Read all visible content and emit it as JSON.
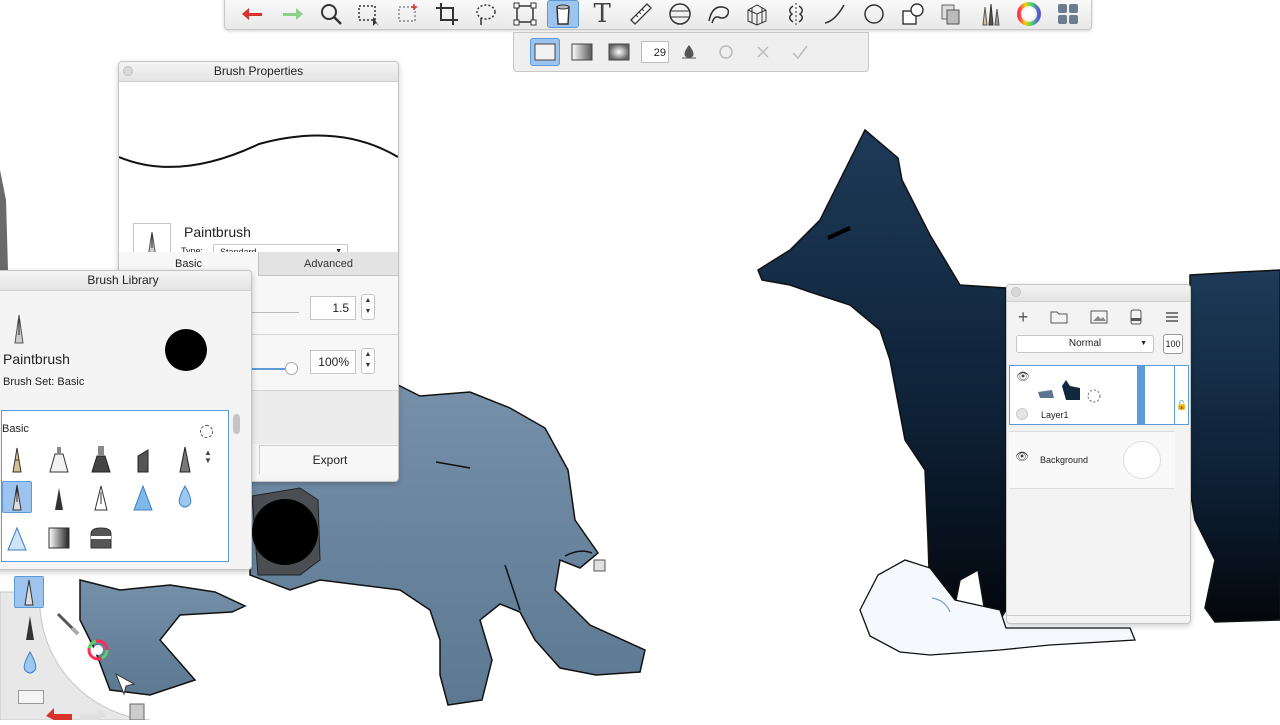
{
  "toolbar": {
    "tools": [
      {
        "name": "undo",
        "icon": "undo-arrow-icon"
      },
      {
        "name": "redo",
        "icon": "redo-arrow-icon"
      },
      {
        "name": "zoom",
        "icon": "magnifier-icon"
      },
      {
        "name": "select",
        "icon": "marquee-select-icon"
      },
      {
        "name": "select-add",
        "icon": "marquee-add-icon"
      },
      {
        "name": "crop",
        "icon": "crop-icon"
      },
      {
        "name": "lasso",
        "icon": "lasso-icon"
      },
      {
        "name": "transform",
        "icon": "transform-icon"
      },
      {
        "name": "fill",
        "icon": "paint-bucket-icon",
        "active": true
      },
      {
        "name": "text",
        "icon": "text-icon",
        "glyph": "T"
      },
      {
        "name": "ruler",
        "icon": "ruler-icon"
      },
      {
        "name": "ellipse-guide",
        "icon": "ellipse-guide-icon"
      },
      {
        "name": "french-curve",
        "icon": "french-curve-icon"
      },
      {
        "name": "perspective",
        "icon": "perspective-icon"
      },
      {
        "name": "symmetry",
        "icon": "symmetry-icon"
      },
      {
        "name": "stroke",
        "icon": "stroke-line-icon"
      },
      {
        "name": "shape",
        "icon": "circle-shape-icon"
      },
      {
        "name": "copy",
        "icon": "copy-paste-icon"
      },
      {
        "name": "layers",
        "icon": "layers-icon"
      },
      {
        "name": "brushes",
        "icon": "brushes-icon"
      },
      {
        "name": "color",
        "icon": "color-wheel-icon"
      },
      {
        "name": "grid",
        "icon": "grid-tiles-icon"
      }
    ]
  },
  "fill_options": {
    "size_value": "29"
  },
  "brush_properties": {
    "title": "Brush Properties",
    "brush_name": "Paintbrush",
    "type_label": "Type:",
    "type_value": "Standard",
    "tabs": [
      "Basic",
      "Advanced"
    ],
    "size_value": "1.5",
    "opacity_value": "100%",
    "export_label": "Export"
  },
  "brush_library": {
    "title": "Brush Library",
    "brush_name": "Paintbrush",
    "brush_set": "Brush Set: Basic",
    "section_label": "Basic"
  },
  "layers": {
    "blend_mode": "Normal",
    "opacity": "100",
    "items": [
      {
        "name": "Layer1",
        "selected": true
      },
      {
        "name": "Background",
        "selected": false
      }
    ]
  },
  "colors": {
    "accent": "#5d9ad9",
    "selection": "#9cc4ef",
    "undo": "#d9312b",
    "redo": "#8ed08a",
    "blue_wolf": "#5b7690",
    "dark_wolf": "#12283f"
  }
}
